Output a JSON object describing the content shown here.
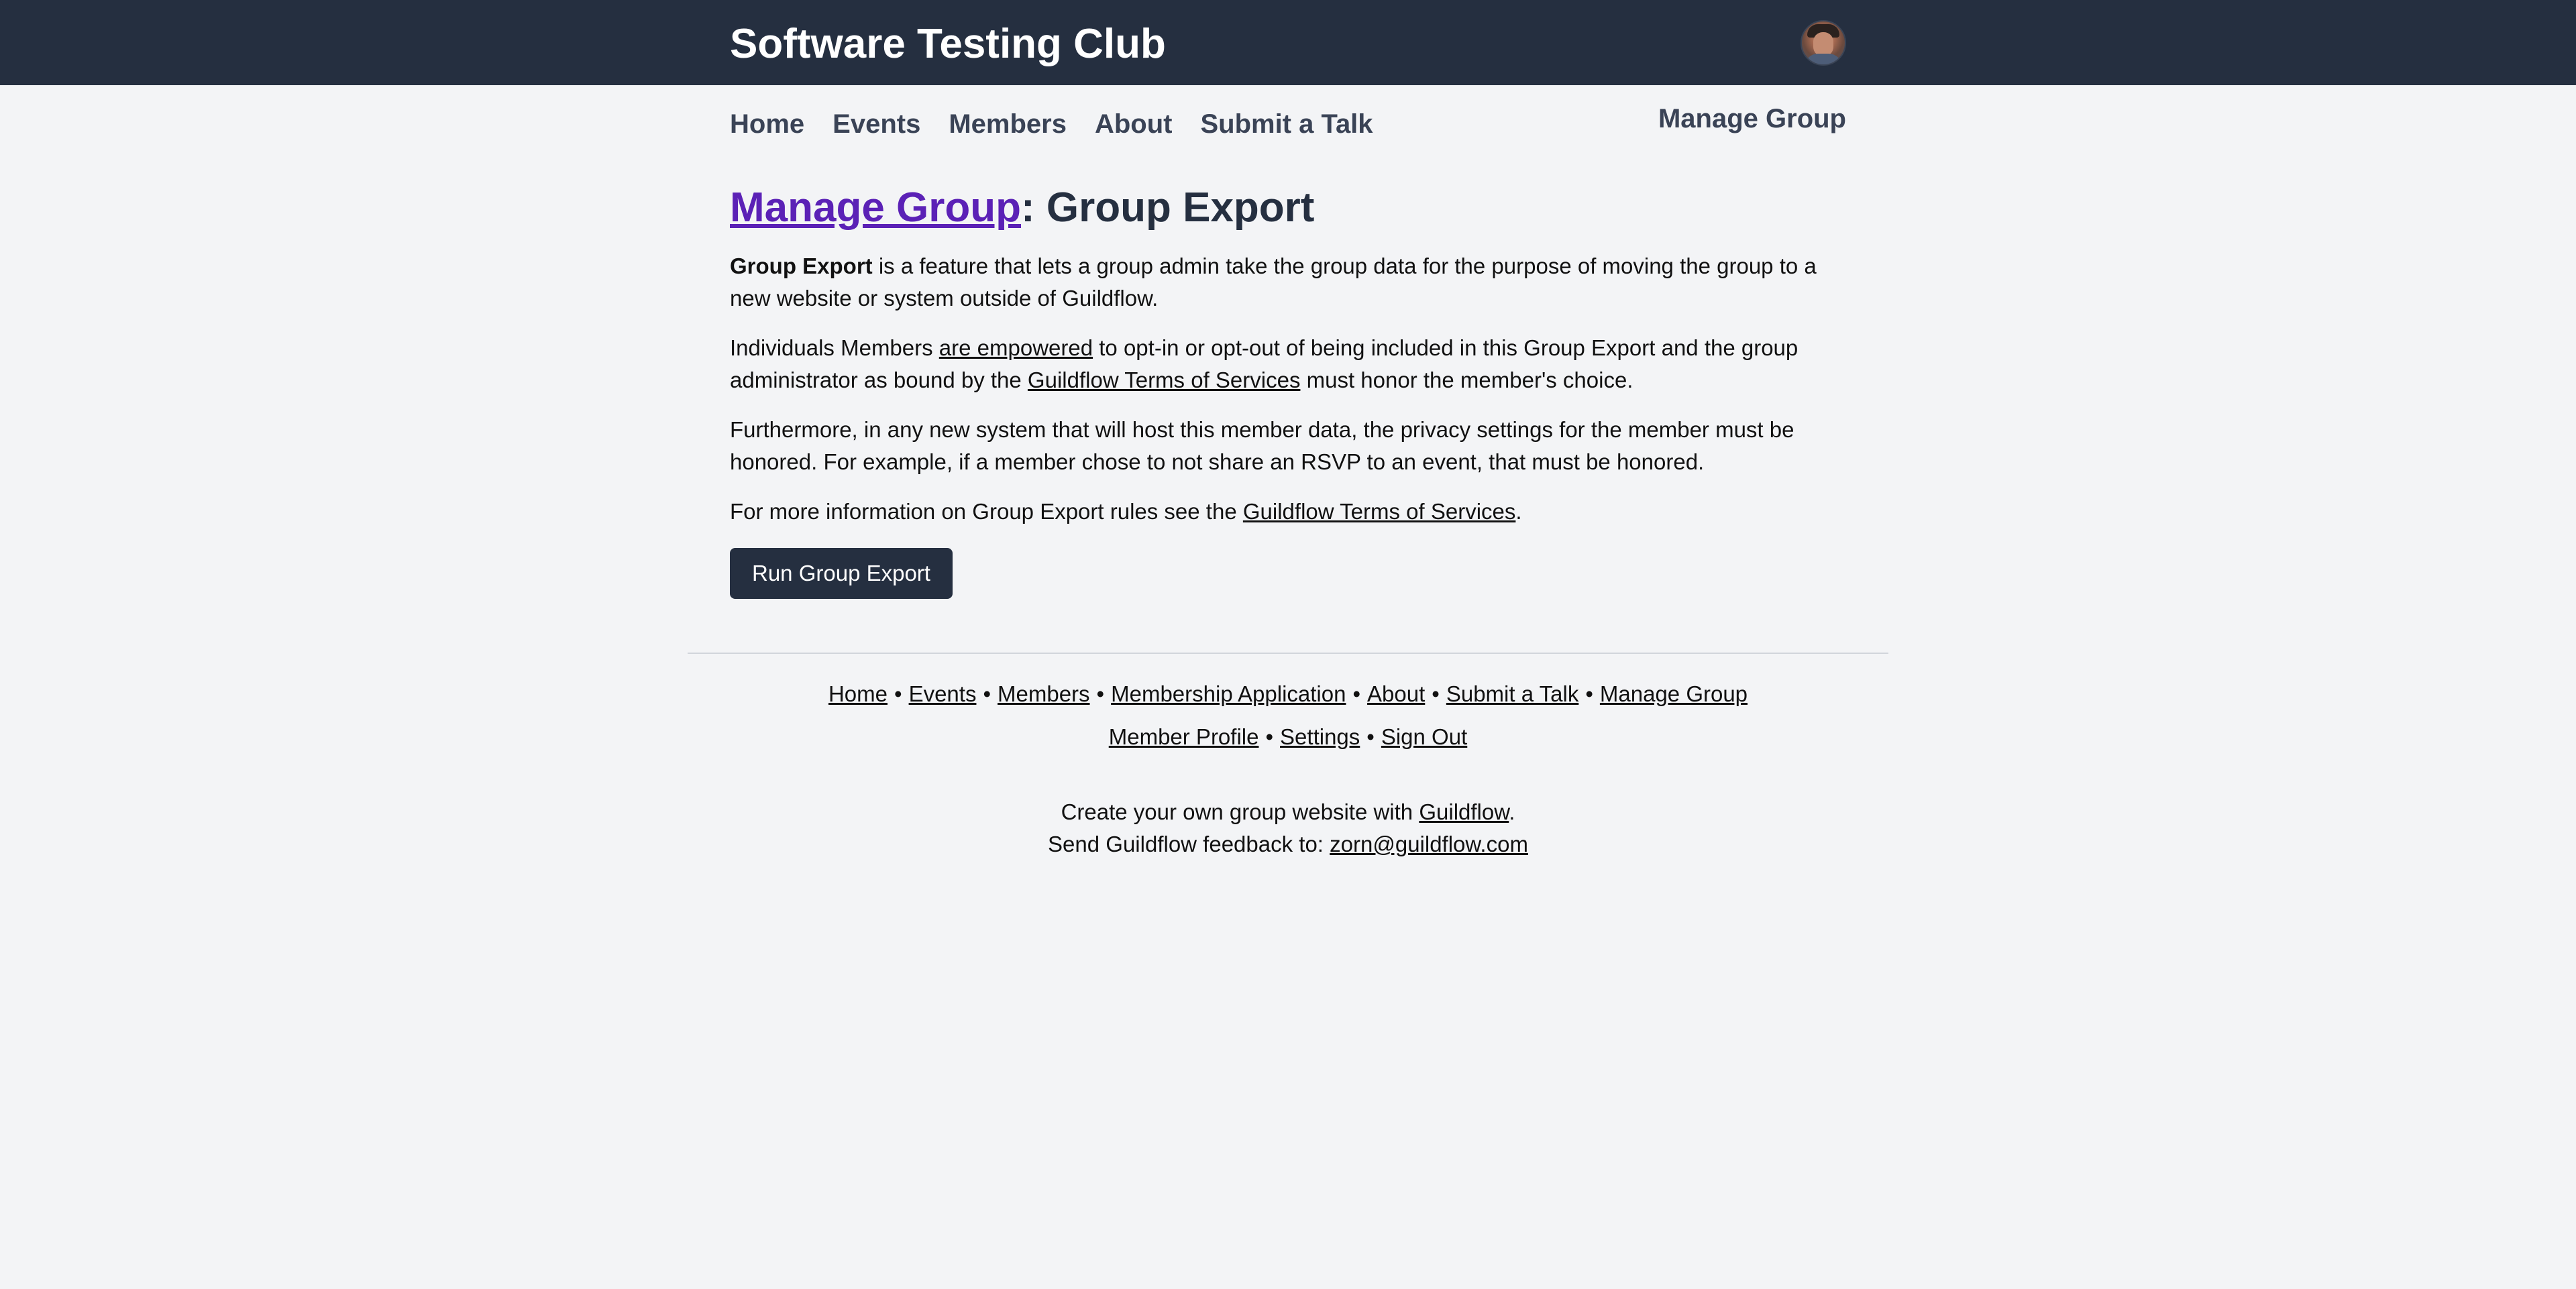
{
  "header": {
    "site_title": "Software Testing Club",
    "avatar_icon": "user-avatar"
  },
  "nav": {
    "links": [
      "Home",
      "Events",
      "Members",
      "About",
      "Submit a Talk"
    ],
    "manage_group": "Manage Group"
  },
  "main": {
    "heading_link": "Manage Group",
    "heading_rest": ": Group Export",
    "p1_bold": "Group Export",
    "p1_text": " is a feature that lets a group admin take the group data for the purpose of moving the group to a new website or system outside of Guildflow.",
    "p2_text1": "Individuals Members ",
    "p2_link1": "are empowered",
    "p2_text2": " to opt-in or opt-out of being included in this Group Export and the group administrator as bound by the ",
    "p2_link2": "Guildflow Terms of Services",
    "p2_text3": " must honor the member's choice.",
    "p3_text": "Furthermore, in any new system that will host this member data, the privacy settings for the member must be honored. For example, if a member chose to not share an RSVP to an event, that must be honored.",
    "p4_text1": "For more information on Group Export rules see the ",
    "p4_link": "Guildflow Terms of Services",
    "p4_text2": ".",
    "run_button": "Run Group Export"
  },
  "footer": {
    "row1": [
      "Home",
      "Events",
      "Members",
      "Membership Application",
      "About",
      "Submit a Talk",
      "Manage Group"
    ],
    "row2": [
      "Member Profile",
      "Settings",
      "Sign Out"
    ],
    "separator": "•",
    "credit_text": "Create your own group website with ",
    "credit_link": "Guildflow",
    "credit_end": ".",
    "feedback_text": "Send Guildflow feedback to: ",
    "feedback_email": "zorn@guildflow.com"
  },
  "colors": {
    "header_bg": "#252f40",
    "page_bg": "#f3f4f6",
    "link_purple": "#5b21b6"
  }
}
